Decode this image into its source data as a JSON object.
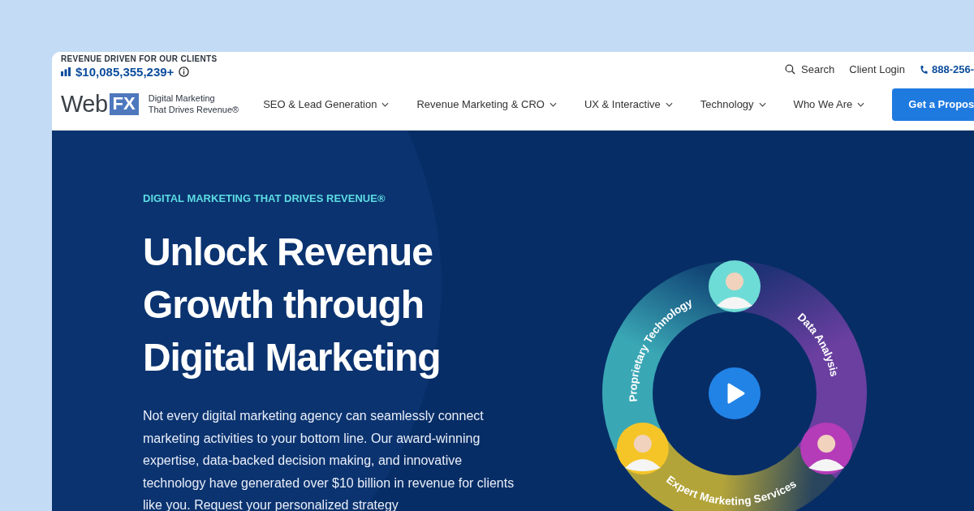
{
  "header": {
    "revenue_caption": "REVENUE DRIVEN FOR OUR CLIENTS",
    "revenue_amount": "$10,085,355,239+",
    "utility_links": [
      {
        "kind": "search",
        "label": "Search"
      },
      {
        "kind": "plain",
        "label": "Client Login"
      },
      {
        "kind": "phone",
        "label": "888-256-"
      }
    ],
    "logo": {
      "text": "Web",
      "badge": "FX"
    },
    "tagline": [
      "Digital Marketing",
      "That Drives Revenue®"
    ],
    "nav": [
      {
        "label": "SEO & Lead Generation"
      },
      {
        "label": "Revenue Marketing & CRO"
      },
      {
        "label": "UX & Interactive"
      },
      {
        "label": "Technology"
      },
      {
        "label": "Who We Are"
      }
    ],
    "cta": "Get a Propos"
  },
  "hero": {
    "eyebrow": "DIGITAL MARKETING THAT DRIVES REVENUE®",
    "headline": [
      "Unlock Revenue",
      "Growth through",
      "Digital Marketing"
    ],
    "body": "Not every digital marketing agency can seamlessly connect marketing activities to your bottom line. Our award-winning expertise, data-backed decision making, and innovative technology have generated over $10 billion in revenue for clients like you. Request your personalized strategy",
    "ring": {
      "segments": [
        {
          "kind": "left",
          "label": "Proprietary Technology",
          "color": "#3aa7b5"
        },
        {
          "kind": "right",
          "label": "Data Analysis",
          "color": "#6a3fa0"
        },
        {
          "kind": "bottom",
          "label": "Expert Marketing Services",
          "color": "#b3a43a"
        }
      ],
      "avatars": [
        {
          "kind": "top",
          "color": "#6edcd6"
        },
        {
          "kind": "left",
          "color": "#f5c528"
        },
        {
          "kind": "right",
          "color": "#b43cb8"
        }
      ]
    }
  }
}
